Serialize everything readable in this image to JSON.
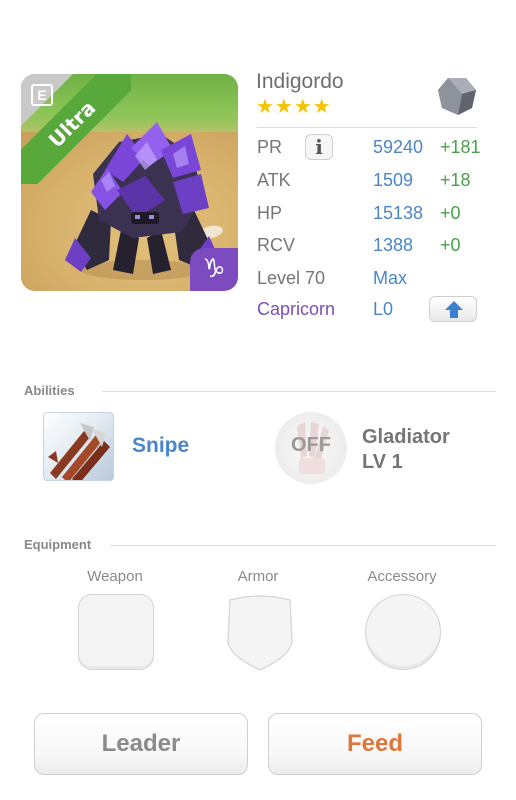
{
  "monster": {
    "name": "Indigordo",
    "stars": "★★★★",
    "rarity": "Ultra",
    "rarity_color": "#58a83c",
    "card_corner_icon": "E",
    "zodiac_symbol": "♑",
    "zodiac_color": "#7b4bbf",
    "element_icon": "stone-element-icon"
  },
  "stats": [
    {
      "label": "PR",
      "value": "59240",
      "bonus": "+181"
    },
    {
      "label": "ATK",
      "value": "1509",
      "bonus": "+18"
    },
    {
      "label": "HP",
      "value": "15138",
      "bonus": "+0"
    },
    {
      "label": "RCV",
      "value": "1388",
      "bonus": "+0"
    }
  ],
  "info_button": "i",
  "level": {
    "label": "Level 70",
    "value": "Max"
  },
  "zodiac": {
    "label": "Capricorn",
    "value": "L0"
  },
  "abilities": {
    "title": "Abilities",
    "primary": {
      "name": "Snipe"
    },
    "secondary": {
      "state": "OFF",
      "name_line1": "Gladiator",
      "name_line2": "LV 1"
    }
  },
  "equipment": {
    "title": "Equipment",
    "slots": [
      {
        "label": "Weapon"
      },
      {
        "label": "Armor"
      },
      {
        "label": "Accessory"
      }
    ]
  },
  "buttons": {
    "leader": "Leader",
    "feed": "Feed"
  },
  "colors": {
    "value_blue": "#4a86c8",
    "bonus_green": "#4aa04a",
    "feed_orange": "#e0763a",
    "capricorn_purple": "#7c4fb4"
  }
}
